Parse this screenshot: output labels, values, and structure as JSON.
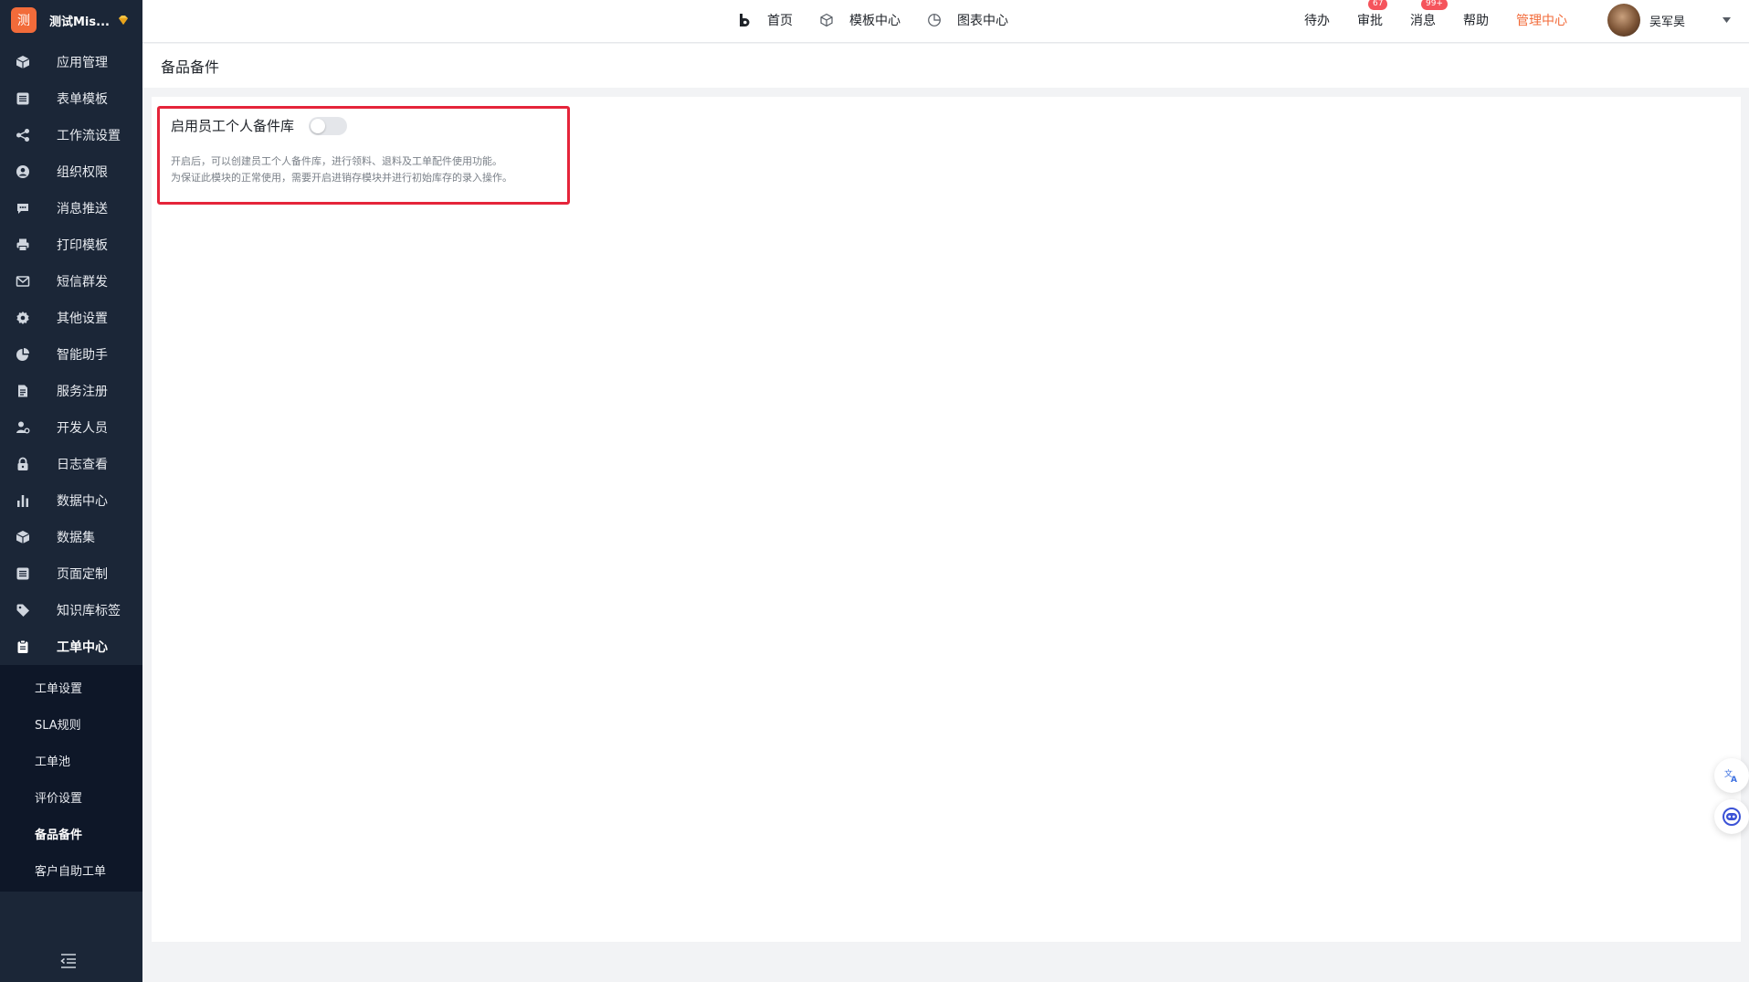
{
  "brand": {
    "logo_char": "测",
    "name": "测试Mis..."
  },
  "sidebar": {
    "items": [
      {
        "label": "应用管理",
        "icon": "cube-icon"
      },
      {
        "label": "表单模板",
        "icon": "form-icon"
      },
      {
        "label": "工作流设置",
        "icon": "workflow-icon"
      },
      {
        "label": "组织权限",
        "icon": "user-circle-icon"
      },
      {
        "label": "消息推送",
        "icon": "chat-icon"
      },
      {
        "label": "打印模板",
        "icon": "printer-icon"
      },
      {
        "label": "短信群发",
        "icon": "mail-icon"
      },
      {
        "label": "其他设置",
        "icon": "gear-icon"
      },
      {
        "label": "智能助手",
        "icon": "pie-icon"
      },
      {
        "label": "服务注册",
        "icon": "document-icon"
      },
      {
        "label": "开发人员",
        "icon": "developer-icon"
      },
      {
        "label": "日志查看",
        "icon": "lock-icon"
      },
      {
        "label": "数据中心",
        "icon": "bar-chart-icon"
      },
      {
        "label": "数据集",
        "icon": "cube-icon"
      },
      {
        "label": "页面定制",
        "icon": "form-icon"
      },
      {
        "label": "知识库标签",
        "icon": "tag-icon"
      },
      {
        "label": "工单中心",
        "icon": "clipboard-icon"
      }
    ],
    "submenu": [
      {
        "label": "工单设置"
      },
      {
        "label": "SLA规则"
      },
      {
        "label": "工单池"
      },
      {
        "label": "评价设置"
      },
      {
        "label": "备品备件"
      },
      {
        "label": "客户自助工单"
      }
    ]
  },
  "topnav": {
    "home": "首页",
    "templates": "模板中心",
    "charts": "图表中心"
  },
  "topright": {
    "todo": "待办",
    "approval": "审批",
    "approval_badge": "67",
    "messages": "消息",
    "messages_badge": "99+",
    "help": "帮助",
    "admin": "管理中心",
    "user_name": "吴军昊"
  },
  "page": {
    "title": "备品备件",
    "setting_label": "启用员工个人备件库",
    "setting_enabled": false,
    "desc_line1": "开启后，可以创建员工个人备件库，进行领料、退料及工单配件使用功能。",
    "desc_line2": "为保证此模块的正常使用，需要开启进销存模块并进行初始库存的录入操作。"
  },
  "colors": {
    "sidebar_bg": "#1b2637",
    "submenu_bg": "#0e1728",
    "accent": "#f26b3a",
    "highlight_border": "#e5243a",
    "badge": "#f5545c"
  }
}
